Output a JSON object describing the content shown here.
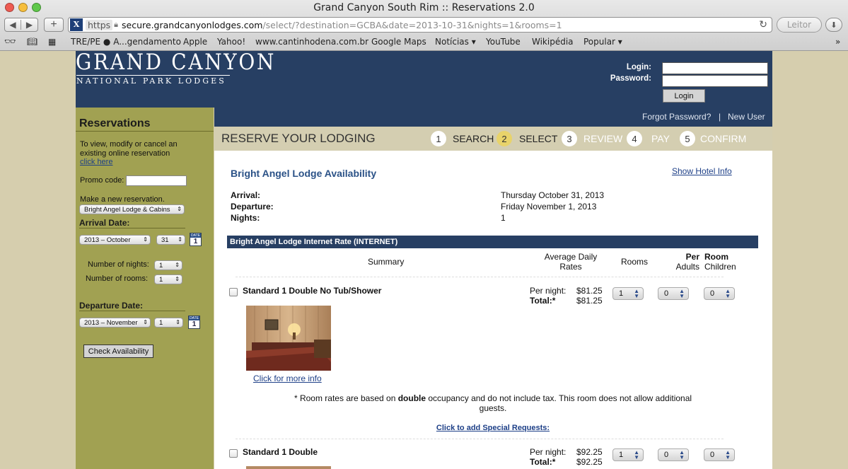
{
  "browser": {
    "window_title": "Grand Canyon South Rim :: Reservations 2.0",
    "url_scheme": "https",
    "url_host": "secure.grandcanyonlodges.com",
    "url_path": "/select/?destination=GCBA&date=2013-10-31&nights=1&rooms=1",
    "reader_label": "Leitor",
    "bookmarks": [
      "TRE/PE ● A...gendamento",
      "Apple",
      "Yahoo!",
      "www.cantinhodena.com.br",
      "Google Maps",
      "Notícias ▾",
      "YouTube",
      "Wikipédia",
      "Popular ▾"
    ]
  },
  "header": {
    "logo_title": "GRAND CANYON",
    "logo_subtitle": "NATIONAL PARK LODGES",
    "login_label": "Login:",
    "password_label": "Password:",
    "login_button": "Login",
    "forgot_password": "Forgot Password?",
    "separator": "|",
    "new_user": "New User"
  },
  "steps": {
    "title": "RESERVE YOUR LODGING",
    "items": [
      {
        "num": "1",
        "label": "SEARCH",
        "active": false
      },
      {
        "num": "2",
        "label": "SELECT",
        "active": true
      },
      {
        "num": "3",
        "label": "REVIEW",
        "active": false
      },
      {
        "num": "4",
        "label": "PAY",
        "active": false
      },
      {
        "num": "5",
        "label": "CONFIRM",
        "active": false
      }
    ]
  },
  "sidebar": {
    "title": "Reservations",
    "intro": "To view, modify or cancel an existing online reservation",
    "click_here": "click here",
    "promo_label": "Promo code:",
    "new_res_label": "Make a new reservation.",
    "hotel_select": "Bright Angel Lodge & Cabins",
    "arrival_label": "Arrival Date:",
    "arrival_month": "2013 – October",
    "arrival_day": "31",
    "calendar_text": "DATE",
    "calendar_num": "1",
    "nights_label": "Number of nights:",
    "nights_value": "1",
    "rooms_label": "Number of rooms:",
    "rooms_value": "1",
    "departure_label": "Departure Date:",
    "departure_month": "2013 – November",
    "departure_day": "1",
    "check_button": "Check Availability"
  },
  "main": {
    "lodge_title": "Bright Angel Lodge Availability",
    "show_hotel_info": "Show Hotel Info",
    "arrival_label": "Arrival:",
    "arrival_value": "Thursday October 31, 2013",
    "departure_label": "Departure:",
    "departure_value": "Friday November 1, 2013",
    "nights_label": "Nights:",
    "nights_value": "1",
    "rate_bar": "Bright Angel Lodge Internet Rate (INTERNET)",
    "col_summary": "Summary",
    "col_rates_1": "Average Daily",
    "col_rates_2": "Rates",
    "col_rooms": "Rooms",
    "col_per_1": "Per",
    "col_per_2": "Adults",
    "col_room_1": "Room",
    "col_room_2": "Children",
    "rooms": [
      {
        "name": "Standard 1 Double No Tub/Shower",
        "per_night_label": "Per night:",
        "per_night": "$81.25",
        "total_label": "Total:*",
        "total": "$81.25",
        "rooms": "1",
        "adults": "0",
        "children": "0",
        "more_info": "Click for more info"
      },
      {
        "name": "Standard 1 Double",
        "per_night_label": "Per night:",
        "per_night": "$92.25",
        "total_label": "Total:*",
        "total": "$92.25",
        "rooms": "1",
        "adults": "0",
        "children": "0"
      }
    ],
    "note_prefix": "* Room rates are based on ",
    "note_bold": "double",
    "note_suffix": " occupancy and do not include tax. This room does not allow additional",
    "note_line2": "guests.",
    "special_requests": "Click to add Special Requests:"
  },
  "colors": {
    "header_navy": "#273f63",
    "sidebar_olive": "#a1a152",
    "steps_tan": "#d4ceb1",
    "active_step": "#e8d36a",
    "link_blue": "#1d3f87"
  }
}
